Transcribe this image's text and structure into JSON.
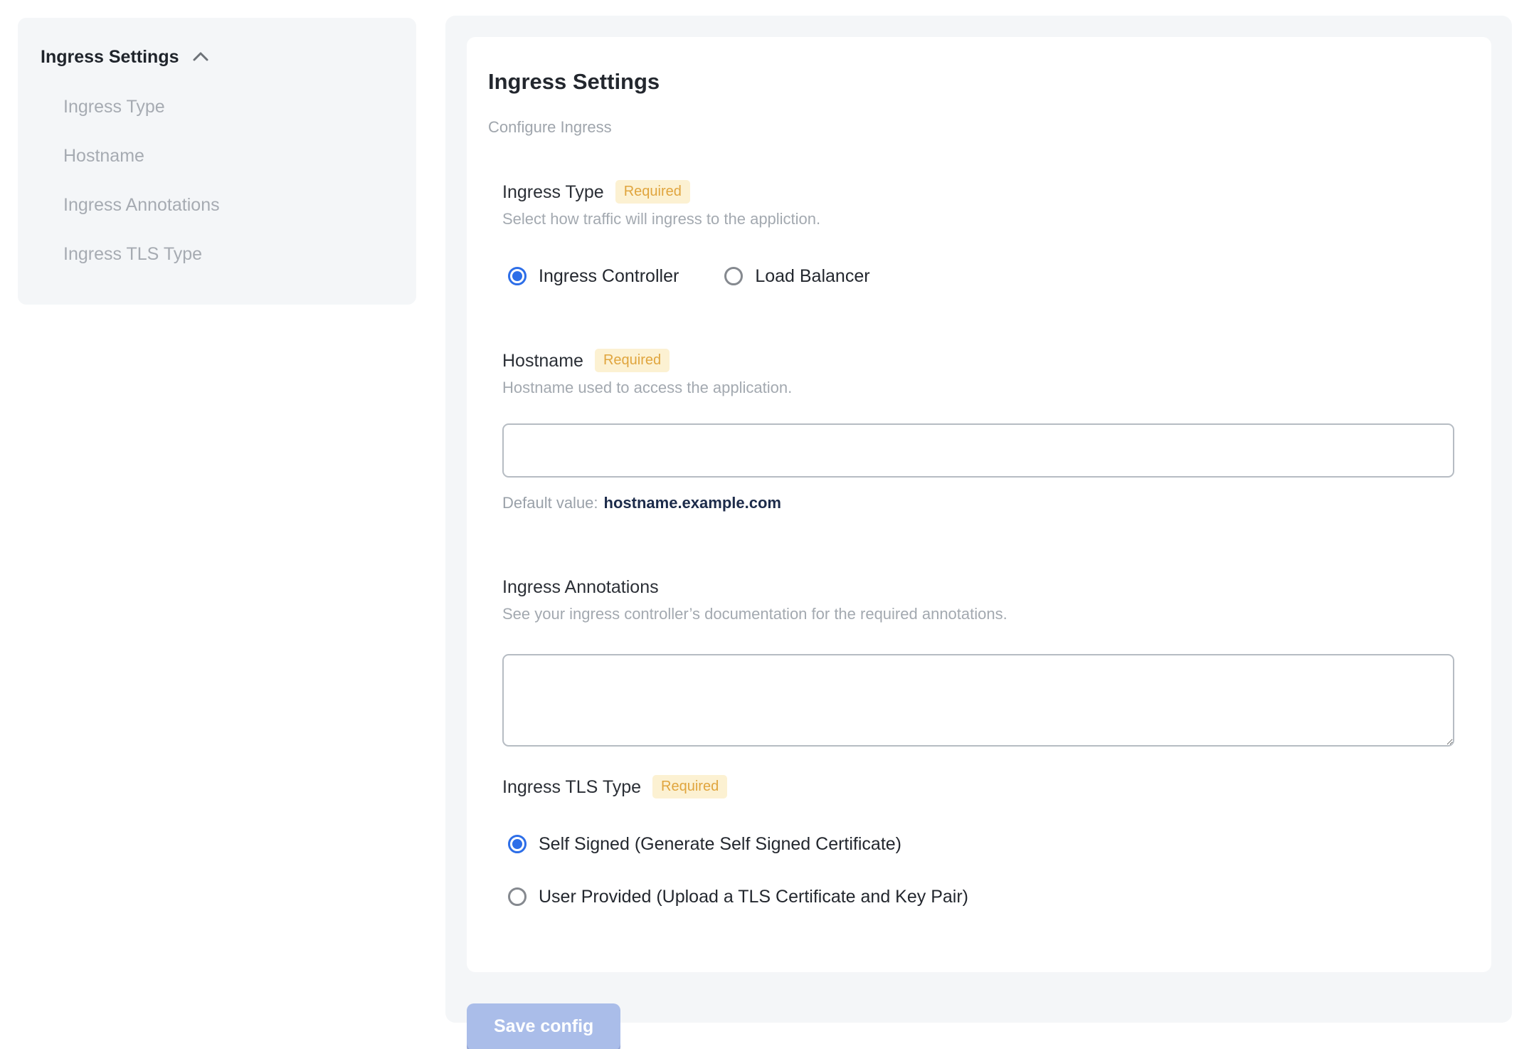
{
  "sidebar": {
    "title": "Ingress Settings",
    "items": [
      {
        "label": "Ingress Type"
      },
      {
        "label": "Hostname"
      },
      {
        "label": "Ingress Annotations"
      },
      {
        "label": "Ingress TLS Type"
      }
    ]
  },
  "panel": {
    "title": "Ingress Settings",
    "subtitle": "Configure Ingress",
    "sections": {
      "ingress_type": {
        "label": "Ingress Type",
        "required": "Required",
        "description": "Select how traffic will ingress to the appliction.",
        "options": [
          {
            "label": "Ingress Controller",
            "selected": true
          },
          {
            "label": "Load Balancer",
            "selected": false
          }
        ]
      },
      "hostname": {
        "label": "Hostname",
        "required": "Required",
        "description": "Hostname used to access the application.",
        "input_value": "",
        "default_value_label": "Default value:",
        "default_value": "hostname.example.com"
      },
      "annotations": {
        "label": "Ingress Annotations",
        "description": "See your ingress controller’s documentation for the required annotations.",
        "textarea_value": ""
      },
      "tls": {
        "label": "Ingress TLS Type",
        "required": "Required",
        "options": [
          {
            "label": "Self Signed (Generate Self Signed Certificate)",
            "selected": true
          },
          {
            "label": "User Provided (Upload a TLS Certificate and Key Pair)",
            "selected": false
          }
        ]
      }
    },
    "save_button": "Save config"
  },
  "colors": {
    "panel_bg": "#f4f6f8",
    "accent_blue": "#2d6ee8",
    "badge_bg": "#fcf1d2",
    "badge_text": "#e0a53e",
    "save_button_bg": "#aabde9",
    "default_value_text": "#1c2b4a"
  }
}
